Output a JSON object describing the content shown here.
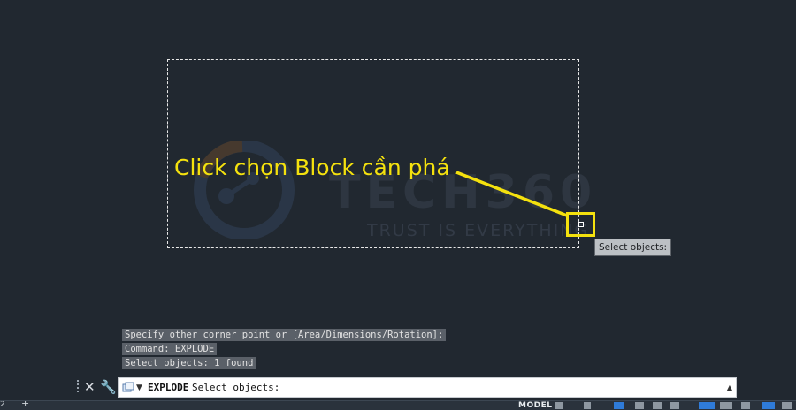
{
  "annotation": {
    "label": "Click chọn Block cần phá",
    "color": "#f4e10e"
  },
  "watermark": {
    "brand": "TECH360",
    "slogan": "TRUST IS EVERYTHING"
  },
  "tooltip": {
    "text": "Select objects:"
  },
  "command_history": [
    "Specify other corner point or [Area/Dimensions/Rotation]:",
    "Command: EXPLODE",
    "Select objects: 1 found"
  ],
  "command_line": {
    "command": "EXPLODE",
    "prompt": "Select objects:",
    "value": "",
    "close_icon": "close-icon",
    "settings_icon": "wrench-icon"
  },
  "status_bar": {
    "layout_number": "2",
    "add_icon": "plus-icon",
    "space_label": "MODEL"
  },
  "colors": {
    "background": "#212830",
    "accent": "#f4e10e",
    "selection": "#e8e8e8"
  }
}
